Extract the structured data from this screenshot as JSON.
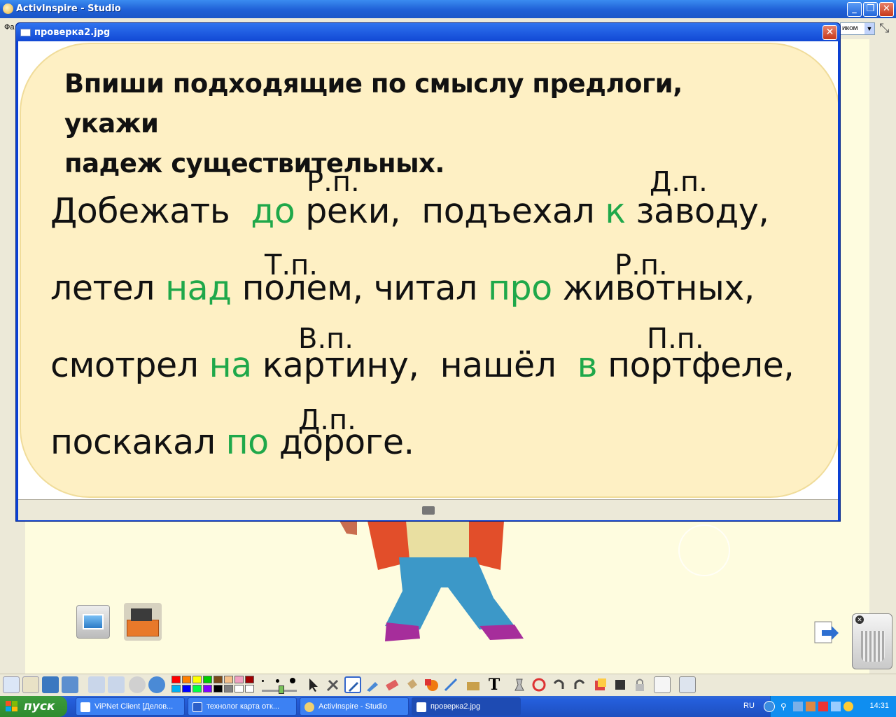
{
  "app": {
    "title": "ActivInspire - Studio",
    "menu_left_text": "Фа",
    "combo_value": "иком"
  },
  "popup": {
    "title": "проверка2.jpg",
    "close_symbol": "✕",
    "instruction_line1": "Впиши подходящие по смыслу предлоги, укажи",
    "instruction_line2": "падеж существительных.",
    "lines": [
      {
        "pre": "Добежать  ",
        "prep1": "до",
        "mid": " реки,  подъехал ",
        "prep2": "к",
        "post": " заводу,"
      },
      {
        "pre": "летел ",
        "prep1": "над",
        "mid": " полем, читал ",
        "prep2": "про",
        "post": " животных,"
      },
      {
        "pre": "смотрел ",
        "prep1": "на",
        "mid": " картину,  нашёл  ",
        "prep2": "в",
        "post": " портфеле,"
      },
      {
        "pre": "поскакал ",
        "prep1": "по",
        "mid": " дороге.",
        "prep2": "",
        "post": ""
      }
    ],
    "cases": [
      "Р.п.",
      "Д.п.",
      "Т.п.",
      "Р.п.",
      "В.п.",
      "П.п.",
      "Д.п."
    ]
  },
  "toolbar": {
    "colors": [
      "#ff0000",
      "#ff8000",
      "#ffff00",
      "#00cc00",
      "#7a4a1a",
      "#f5c08a",
      "#f0a0c0",
      "#a00000",
      "#00b0f0",
      "#0000ff",
      "#00ff40",
      "#8000ff",
      "#000000",
      "#808080",
      "#ffffff",
      "#ffffff"
    ]
  },
  "taskbar": {
    "start_label": "пуск",
    "tasks": [
      {
        "label": "ViPNet Client [Делов...",
        "active": false
      },
      {
        "label": "технолог карта отк...",
        "active": false
      },
      {
        "label": "ActivInspire - Studio",
        "active": false
      },
      {
        "label": "проверка2.jpg",
        "active": true
      }
    ],
    "lang": "RU",
    "clock": "14:31"
  }
}
